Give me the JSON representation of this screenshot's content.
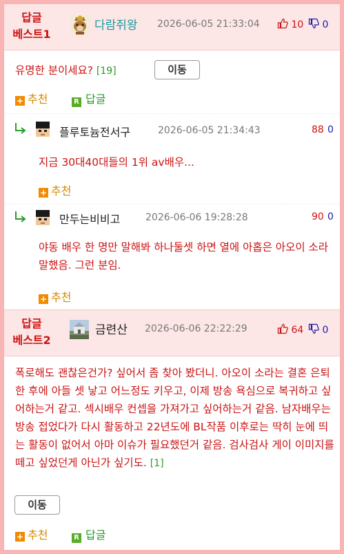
{
  "posts": [
    {
      "badge_line1": "답글",
      "badge_line2": "베스트1",
      "username": "다람쥐왕",
      "timestamp": "2026-06-05 21:33:04",
      "upvotes": "10",
      "downvotes": "0",
      "title": "유명한 분이세요?",
      "reply_count": "[19]",
      "move_label": "이동",
      "recommend_label": "추천",
      "reply_label": "답글"
    },
    {
      "badge_line1": "답글",
      "badge_line2": "베스트2",
      "username": "금련산",
      "timestamp": "2026-06-06 22:22:29",
      "upvotes": "64",
      "downvotes": "0",
      "body": "폭로해도 괜찮은건가? 싶어서 좀 찾아 봤더니. 아오이 소라는 결혼 은퇴한 후에 아들 셋 낳고 어느정도 키우고, 이제 방송 욕심으로 복귀하고 싶어하는거 같고. 섹시배우 컨셉을 가져가고 싶어하는거 같음. 남자배우는 방송 접었다가 다시 활동하고 22년도에 BL작품 이후로는 딱히 눈에 띄는 활동이 없어서 아마 이슈가 필요했던거 같음. 검사검사 게이 이미지를 떼고 싶었던게 아닌가 싶기도.",
      "reply_count": "[1]",
      "move_label": "이동",
      "recommend_label": "추천",
      "reply_label": "답글"
    }
  ],
  "comments": [
    {
      "username": "플루토늄전서구",
      "timestamp": "2026-06-05 21:34:43",
      "upvotes": "88",
      "downvotes": "0",
      "text": "지금 30대40대들의 1위 av배우...",
      "recommend_label": "추천"
    },
    {
      "username": "만두는비비고",
      "timestamp": "2026-06-06 19:28:28",
      "upvotes": "90",
      "downvotes": "0",
      "text": "야동 배우 한 명만 말해봐 하나둘셋 하면 열에 아홉은 아오이 소라 말했음. 그런 분임.",
      "recommend_label": "추천"
    }
  ]
}
